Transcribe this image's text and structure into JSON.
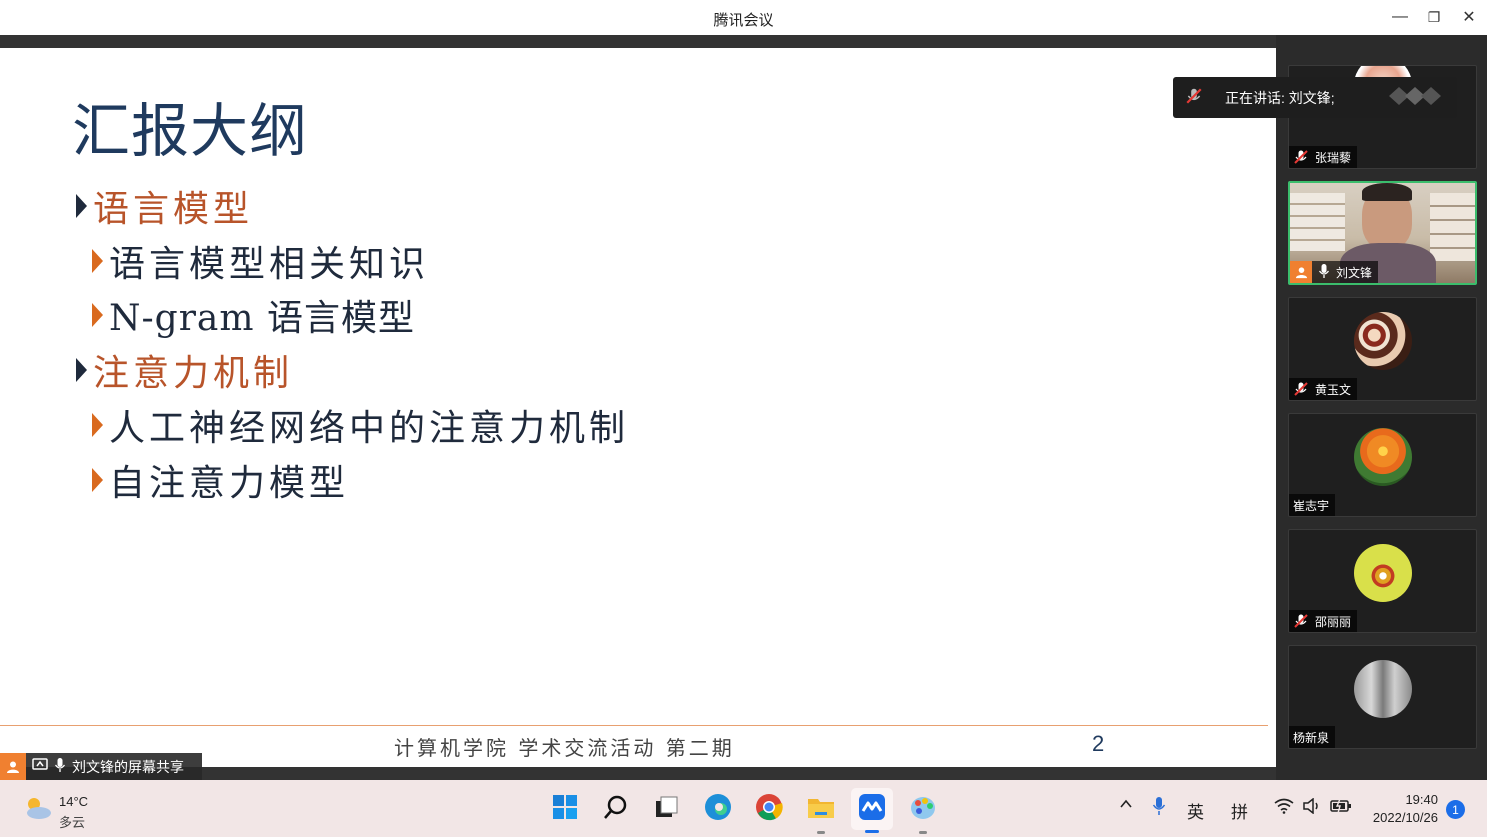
{
  "window": {
    "title": "腾讯会议",
    "minimize_glyph": "—",
    "restore_glyph": "❐",
    "close_glyph": "✕"
  },
  "slide": {
    "title": "汇报大纲",
    "bullets": [
      {
        "level": 1,
        "text": "语言模型"
      },
      {
        "level": 2,
        "text": "语言模型相关知识"
      },
      {
        "level": 2,
        "text": "N-gram 语言模型"
      },
      {
        "level": 1,
        "text": "注意力机制"
      },
      {
        "level": 2,
        "text": "人工神经网络中的注意力机制"
      },
      {
        "level": 2,
        "text": "自注意力模型"
      }
    ],
    "footer": "计算机学院 学术交流活动 第二期",
    "page_number": "2"
  },
  "share_badge": {
    "label": "刘文锋的屏幕共享"
  },
  "speaking": {
    "label": "正在讲话: 刘文锋;"
  },
  "participants": [
    {
      "name": "张瑞藜",
      "mic": "muted"
    },
    {
      "name": "刘文锋",
      "mic": "on",
      "video": true
    },
    {
      "name": "黄玉文",
      "mic": "muted"
    },
    {
      "name": "崔志宇",
      "mic": "none"
    },
    {
      "name": "邵丽丽",
      "mic": "muted"
    },
    {
      "name": "杨新泉",
      "mic": "none"
    }
  ],
  "taskbar": {
    "weather_temp": "14°C",
    "weather_desc": "多云",
    "ime_lang": "英",
    "ime_mode": "拼",
    "time": "19:40",
    "date": "2022/10/26",
    "notification_count": "1"
  },
  "colors": {
    "accent_green": "#3bbd6c",
    "slide_title": "#1f3a5e",
    "level1_text": "#b8542a",
    "bullet_orange": "#d96a1f"
  }
}
